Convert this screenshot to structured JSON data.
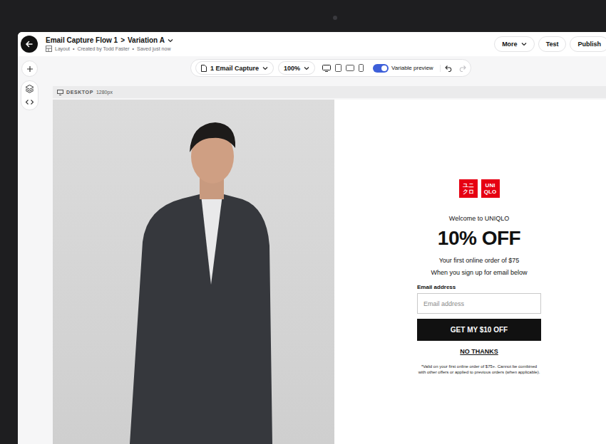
{
  "header": {
    "back": {
      "label": "Back"
    },
    "title": "Email Capture Flow 1",
    "separator": ">",
    "variation": "Variation A",
    "meta_separator": "•",
    "meta": [
      "Layout",
      "Created by Todd Faster",
      "Saved just now"
    ],
    "buttons": [
      {
        "label": "More",
        "kind": "dropdown"
      },
      {
        "label": "Test",
        "kind": "plain"
      },
      {
        "label": "Publish",
        "kind": "plain"
      }
    ]
  },
  "toolbar": {
    "page_select": "1 Email Capture",
    "zoom": "100%",
    "devices": [
      {
        "kind": "desktop"
      },
      {
        "kind": "tablet"
      },
      {
        "kind": "landscape"
      },
      {
        "kind": "mobile"
      }
    ],
    "variable_preview": {
      "label": "Variable preview",
      "on": true
    },
    "undo": {
      "disabled": false
    },
    "redo": {
      "disabled": true
    }
  },
  "canvas": {
    "device": "DESKTOP",
    "width": "1280px"
  },
  "popup": {
    "logo": {
      "left": [
        "ユニ",
        "クロ"
      ],
      "right": [
        "UNI",
        "QLO"
      ]
    },
    "welcome": "Welcome to UNIQLO",
    "headline": "10% OFF",
    "lines": [
      "Your first online order of $75",
      "When you sign up for email below"
    ],
    "field_label": "Email address",
    "placeholder": "Email address",
    "cta": "GET MY $10 OFF",
    "decline": "NO THANKS",
    "disclaimer": "*Valid on your first online order of $75+. Cannot be combined with other offers or applied to previous orders (when applicable)."
  }
}
